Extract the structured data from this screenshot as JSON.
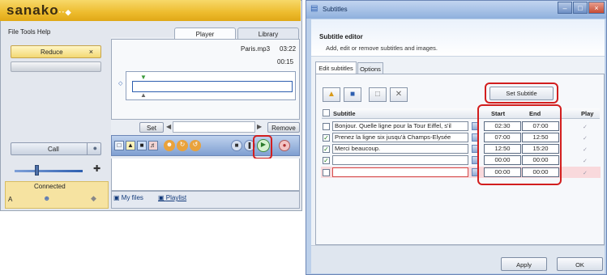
{
  "sanako": {
    "logo": "sanako",
    "logo_mark": "··◆",
    "close_glyph": "_ ×",
    "menu": "File  Tools  Help",
    "reduce_label": "Reduce",
    "reduce_close": "×",
    "call_label": "Call",
    "volume_level": 0.32,
    "connected_label": "Connected",
    "status_letter": "A",
    "tabs": [
      "Player",
      "Library"
    ],
    "file_name": "Paris.mp3",
    "file_duration": "03:22",
    "position_time": "00:15",
    "set_label": "Set",
    "remove_label": "Remove",
    "bottom_tabs": [
      "My files",
      "Playlist"
    ]
  },
  "subtitles": {
    "window_title": "Subtitles",
    "editor_title": "Subtitle editor",
    "editor_description": "Add, edit or remove subtitles and images.",
    "tabs": [
      "Edit subtitles",
      "Options"
    ],
    "set_subtitle_label": "Set Subtitle",
    "columns": [
      "Subtitle",
      "Start",
      "End",
      "Play"
    ],
    "rows": [
      {
        "checked": false,
        "text": "Bonjour. Quelle ligne pour la Tour Eiffel, s'il",
        "start": "02:30",
        "end": "07:00",
        "play": "✓"
      },
      {
        "checked": true,
        "text": "Prenez la ligne six jusqu'à Champs-Elysée",
        "start": "07:00",
        "end": "12:50",
        "play": "✓"
      },
      {
        "checked": true,
        "text": "Merci beaucoup.",
        "start": "12:50",
        "end": "15:20",
        "play": "✓"
      },
      {
        "checked": true,
        "text": "",
        "start": "00:00",
        "end": "00:00",
        "play": "✓"
      },
      {
        "checked": false,
        "text": "",
        "start": "00:00",
        "end": "00:00",
        "play": "✓"
      }
    ],
    "apply_label": "Apply",
    "ok_label": "OK",
    "highlight_color": "#d21e1e"
  }
}
